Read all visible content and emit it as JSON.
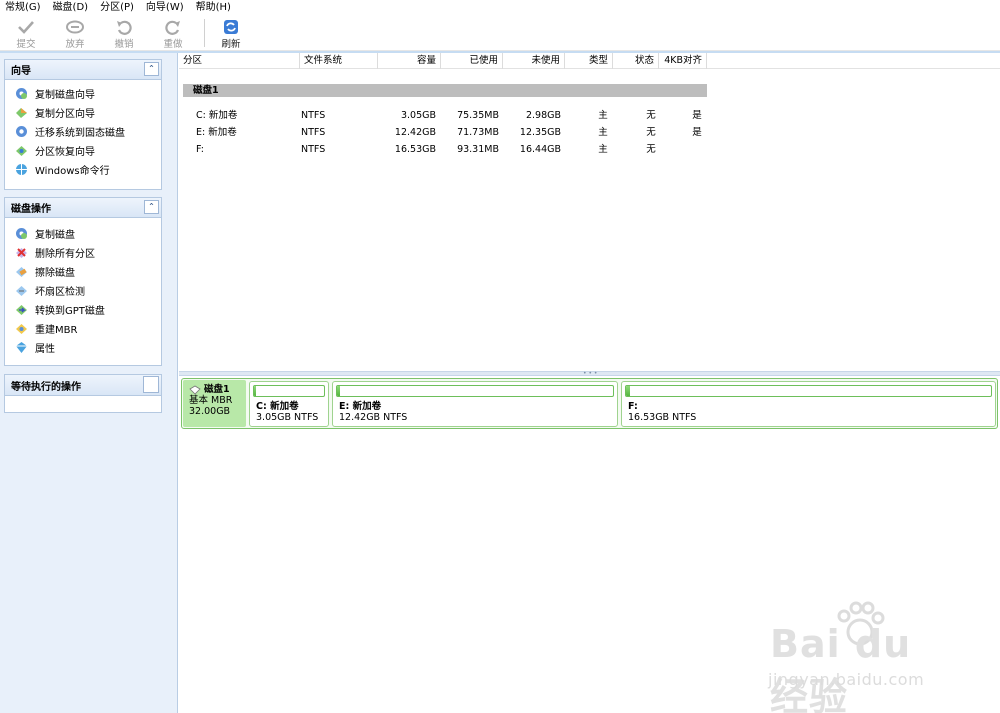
{
  "menubar": {
    "items": [
      "常规(G)",
      "磁盘(D)",
      "分区(P)",
      "向导(W)",
      "帮助(H)"
    ]
  },
  "toolbar": {
    "buttons": [
      {
        "label": "提交",
        "icon": "check-icon",
        "enabled": false
      },
      {
        "label": "放弃",
        "icon": "discard-icon",
        "enabled": false
      },
      {
        "label": "撤销",
        "icon": "undo-icon",
        "enabled": false
      },
      {
        "label": "重做",
        "icon": "redo-icon",
        "enabled": false
      },
      {
        "label": "刷新",
        "icon": "refresh-icon",
        "enabled": true
      }
    ]
  },
  "sidebar": {
    "wizard": {
      "title": "向导",
      "items": [
        "复制磁盘向导",
        "复制分区向导",
        "迁移系统到固态磁盘",
        "分区恢复向导",
        "Windows命令行"
      ]
    },
    "disk_ops": {
      "title": "磁盘操作",
      "items": [
        "复制磁盘",
        "删除所有分区",
        "擦除磁盘",
        "坏扇区检测",
        "转换到GPT磁盘",
        "重建MBR",
        "属性"
      ]
    },
    "pending": {
      "title": "等待执行的操作"
    }
  },
  "table": {
    "headers": [
      "分区",
      "文件系统",
      "容量",
      "已使用",
      "未使用",
      "类型",
      "状态",
      "4KB对齐"
    ],
    "disk_title": "磁盘1",
    "rows": [
      {
        "partition": "C: 新加卷",
        "fs": "NTFS",
        "capacity": "3.05GB",
        "used": "75.35MB",
        "unused": "2.98GB",
        "type": "主",
        "status": "无",
        "aligned": "是"
      },
      {
        "partition": "E: 新加卷",
        "fs": "NTFS",
        "capacity": "12.42GB",
        "used": "71.73MB",
        "unused": "12.35GB",
        "type": "主",
        "status": "无",
        "aligned": "是"
      },
      {
        "partition": "F:",
        "fs": "NTFS",
        "capacity": "16.53GB",
        "used": "93.31MB",
        "unused": "16.44GB",
        "type": "主",
        "status": "无",
        "aligned": ""
      }
    ]
  },
  "disk_map": {
    "disk_name": "磁盘1",
    "disk_type": "基本 MBR",
    "disk_size": "32.00GB",
    "partitions": [
      {
        "label": "C: 新加卷",
        "size": "3.05GB NTFS",
        "used_fraction": 0.03
      },
      {
        "label": "E: 新加卷",
        "size": "12.42GB NTFS",
        "used_fraction": 0.01
      },
      {
        "label": "F:",
        "size": "16.53GB NTFS",
        "used_fraction": 0.01
      }
    ]
  },
  "watermark": {
    "main": "Bai du 经验",
    "sub": "jingyan.baidu.com"
  },
  "colors": {
    "accent_blue": "#3a7bd5",
    "partition_green": "#55b640",
    "disk_info_green": "#b8e8a8",
    "disk_title_gray": "#bdbdbd"
  }
}
